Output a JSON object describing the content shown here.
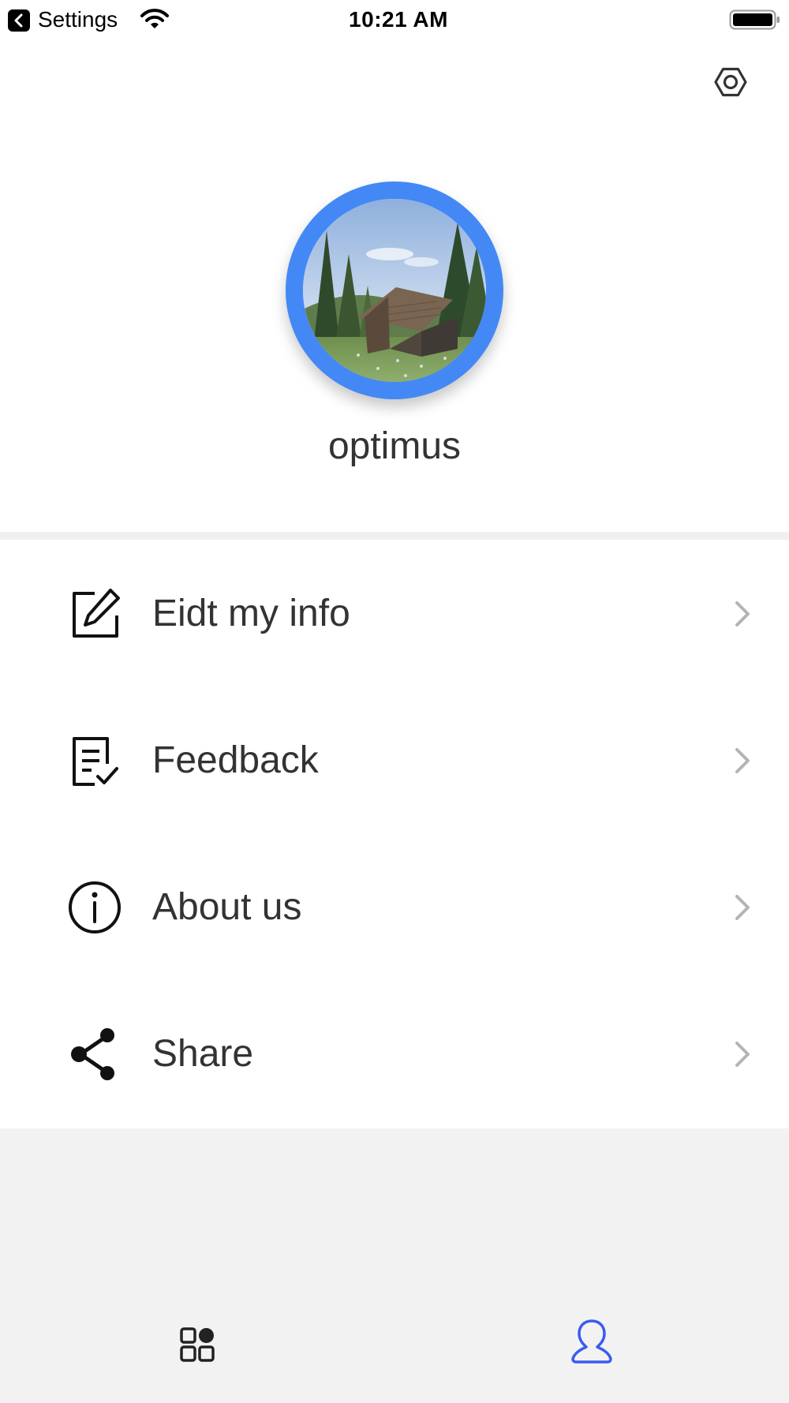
{
  "status_bar": {
    "back_label": "Settings",
    "time": "10:21 AM",
    "wifi_icon": "wifi-icon",
    "battery_icon": "battery-full-icon"
  },
  "header": {
    "settings_icon": "gear-icon",
    "username": "optimus",
    "avatar_ring_color": "#4488f5"
  },
  "menu": {
    "items": [
      {
        "label": "Eidt my info",
        "icon": "edit-icon"
      },
      {
        "label": "Feedback",
        "icon": "feedback-icon"
      },
      {
        "label": "About us",
        "icon": "info-icon"
      },
      {
        "label": "Share",
        "icon": "share-icon"
      }
    ],
    "chevron_icon": "chevron-right-icon"
  },
  "tab_bar": {
    "tabs": [
      {
        "icon": "apps-icon",
        "active": false
      },
      {
        "icon": "user-icon",
        "active": true
      }
    ],
    "active_color": "#3b5bf0",
    "inactive_color": "#222222"
  }
}
